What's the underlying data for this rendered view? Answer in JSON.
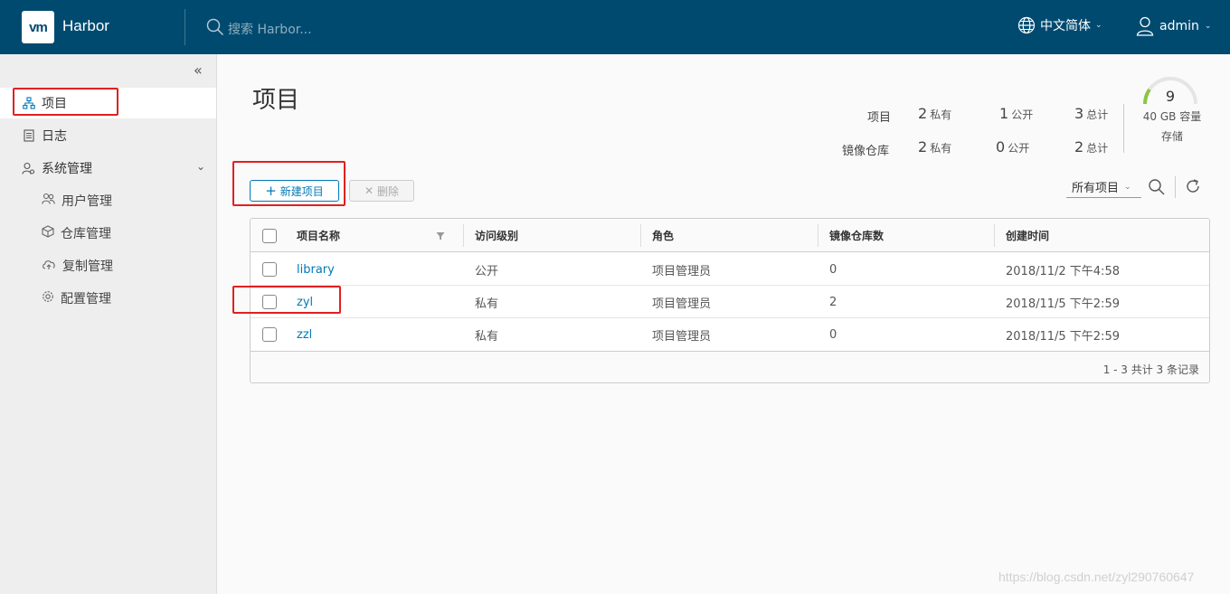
{
  "header": {
    "logo_text": "vm",
    "brand": "Harbor",
    "search_placeholder": "搜索 Harbor...",
    "language": "中文简体",
    "user": "admin"
  },
  "sidebar": {
    "items": [
      {
        "label": "项目",
        "icon": "projects-icon",
        "active": true
      },
      {
        "label": "日志",
        "icon": "logs-icon"
      },
      {
        "label": "系统管理",
        "icon": "admin-icon",
        "expanded": true
      }
    ],
    "sub_items": [
      {
        "label": "用户管理",
        "icon": "users-icon"
      },
      {
        "label": "仓库管理",
        "icon": "registry-icon"
      },
      {
        "label": "复制管理",
        "icon": "replication-icon"
      },
      {
        "label": "配置管理",
        "icon": "config-icon"
      }
    ]
  },
  "main": {
    "title": "项目",
    "stats": {
      "row1_label": "项目",
      "row2_label": "镜像仓库",
      "projects": {
        "private": "2",
        "public": "1",
        "total": "3"
      },
      "repos": {
        "private": "2",
        "public": "0",
        "total": "2"
      },
      "private_label": "私有",
      "public_label": "公开",
      "total_label": "总计"
    },
    "storage": {
      "value": "9",
      "capacity": "40 GB 容量",
      "label": "存储"
    },
    "buttons": {
      "new_project": "新建项目",
      "delete": "删除"
    },
    "filter": {
      "selected": "所有项目"
    },
    "table": {
      "columns": [
        "项目名称",
        "访问级别",
        "角色",
        "镜像仓库数",
        "创建时间"
      ],
      "rows": [
        {
          "name": "library",
          "access": "公开",
          "role": "项目管理员",
          "repos": "0",
          "created": "2018/11/2 下午4:58"
        },
        {
          "name": "zyl",
          "access": "私有",
          "role": "项目管理员",
          "repos": "2",
          "created": "2018/11/5 下午2:59"
        },
        {
          "name": "zzl",
          "access": "私有",
          "role": "项目管理员",
          "repos": "0",
          "created": "2018/11/5 下午2:59"
        }
      ],
      "footer": "1 - 3 共计 3 条记录"
    }
  },
  "watermark": "https://blog.csdn.net/zyl290760647",
  "colors": {
    "header_bg": "#004a70",
    "accent": "#0079b8",
    "annotation": "#e02020"
  }
}
